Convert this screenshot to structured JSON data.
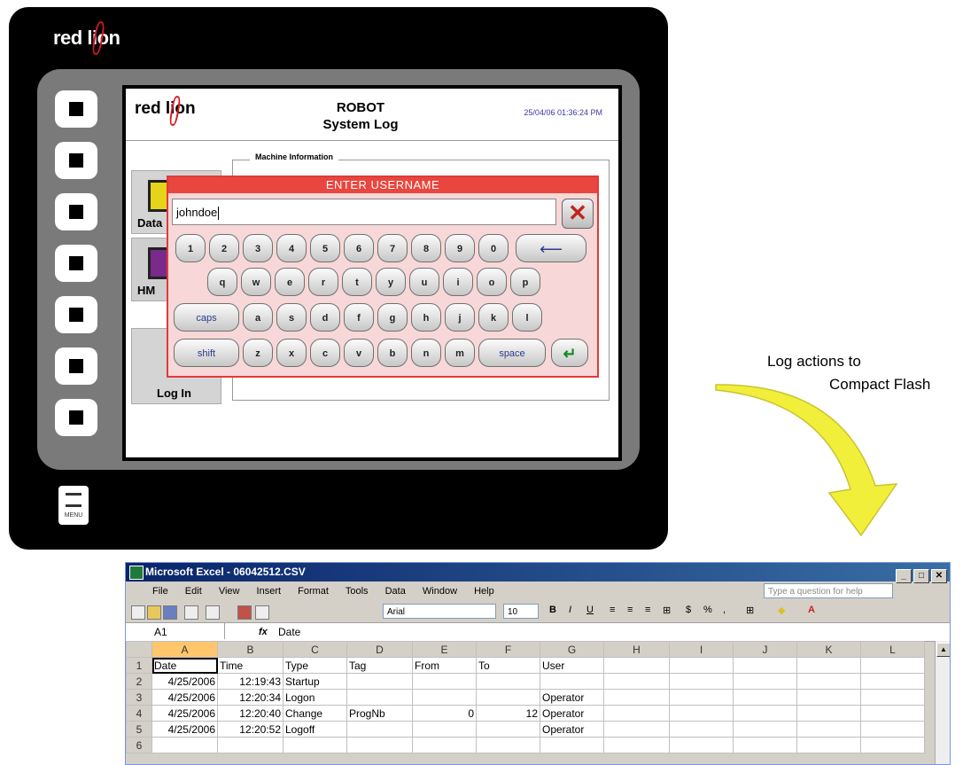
{
  "device": {
    "brand": "red lion",
    "menu_label": "MENU",
    "screen": {
      "logo": "red lion",
      "title_line1": "ROBOT",
      "title_line2": "System Log",
      "datetime": "25/04/06 01:36:24 PM",
      "section_label": "Machine Information",
      "side_buttons": [
        "Data",
        "HM",
        "Log In"
      ],
      "keyboard": {
        "title": "ENTER USERNAME",
        "input_value": "johndoe",
        "clear_glyph": "✕",
        "row1": [
          "1",
          "2",
          "3",
          "4",
          "5",
          "6",
          "7",
          "8",
          "9",
          "0"
        ],
        "backspace_glyph": "⟵",
        "row2": [
          "q",
          "w",
          "e",
          "r",
          "t",
          "y",
          "u",
          "i",
          "o",
          "p"
        ],
        "caps_label": "caps",
        "row3": [
          "a",
          "s",
          "d",
          "f",
          "g",
          "h",
          "j",
          "k",
          "l"
        ],
        "shift_label": "shift",
        "row4": [
          "z",
          "x",
          "c",
          "v",
          "b",
          "n",
          "m"
        ],
        "space_label": "space",
        "enter_glyph": "↵"
      }
    }
  },
  "annotation": {
    "line1": "Log actions to",
    "line2": "Compact Flash"
  },
  "excel": {
    "title": "Microsoft Excel - 06042512.CSV",
    "menu": [
      "File",
      "Edit",
      "View",
      "Insert",
      "Format",
      "Tools",
      "Data",
      "Window",
      "Help"
    ],
    "help_placeholder": "Type a question for help",
    "font_name": "Arial",
    "font_size": "10",
    "name_box": "A1",
    "fx": "fx",
    "formula_value": "Date",
    "columns": [
      "A",
      "B",
      "C",
      "D",
      "E",
      "F",
      "G",
      "H",
      "I",
      "J",
      "K",
      "L"
    ],
    "rows": [
      {
        "n": "1",
        "cells": [
          "Date",
          "Time",
          "Type",
          "Tag",
          "From",
          "To",
          "User",
          "",
          "",
          "",
          "",
          ""
        ]
      },
      {
        "n": "2",
        "cells": [
          "4/25/2006",
          "12:19:43",
          "Startup",
          "",
          "",
          "",
          "",
          "",
          "",
          "",
          "",
          ""
        ]
      },
      {
        "n": "3",
        "cells": [
          "4/25/2006",
          "12:20:34",
          "Logon",
          "",
          "",
          "",
          "Operator",
          "",
          "",
          "",
          "",
          ""
        ]
      },
      {
        "n": "4",
        "cells": [
          "4/25/2006",
          "12:20:40",
          "Change",
          "ProgNb",
          "0",
          "12",
          "Operator",
          "",
          "",
          "",
          "",
          ""
        ]
      },
      {
        "n": "5",
        "cells": [
          "4/25/2006",
          "12:20:52",
          "Logoff",
          "",
          "",
          "",
          "Operator",
          "",
          "",
          "",
          "",
          ""
        ]
      },
      {
        "n": "6",
        "cells": [
          "",
          "",
          "",
          "",
          "",
          "",
          "",
          "",
          "",
          "",
          "",
          ""
        ]
      }
    ]
  },
  "colors": {
    "brand_red": "#d71920",
    "keyboard_header": "#e8463e",
    "keyboard_bg": "#f7d7d7",
    "arrow_yellow": "#f2ef3a"
  }
}
